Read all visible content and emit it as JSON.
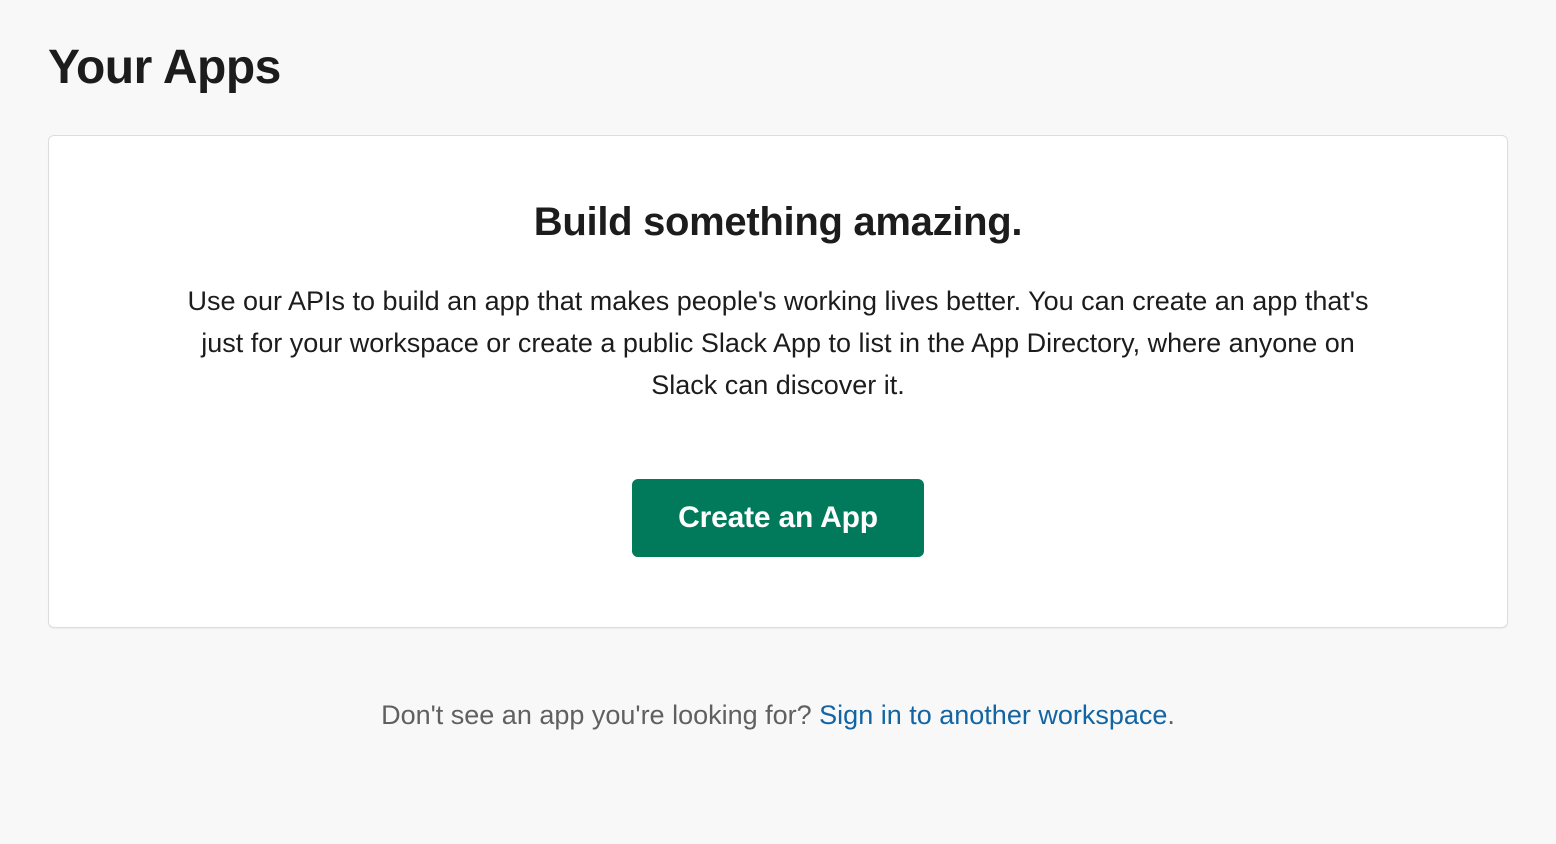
{
  "page": {
    "title": "Your Apps"
  },
  "panel": {
    "heading": "Build something amazing.",
    "description": "Use our APIs to build an app that makes people's working lives better. You can create an app that's just for your workspace or create a public Slack App to list in the App Directory, where anyone on Slack can discover it.",
    "cta_label": "Create an App"
  },
  "footer": {
    "prompt": "Don't see an app you're looking for? ",
    "link_text": "Sign in to another workspace",
    "period": "."
  }
}
